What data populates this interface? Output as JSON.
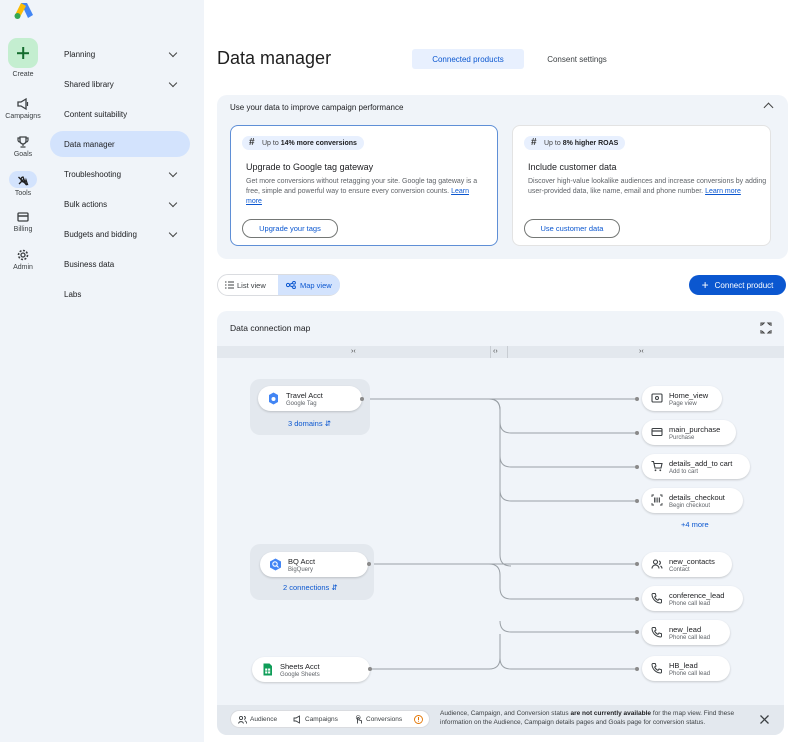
{
  "rail": {
    "items": [
      {
        "label": "Create",
        "icon": "plus-icon"
      },
      {
        "label": "Campaigns",
        "icon": "megaphone-icon"
      },
      {
        "label": "Goals",
        "icon": "trophy-icon"
      },
      {
        "label": "Tools",
        "icon": "tools-icon"
      },
      {
        "label": "Billing",
        "icon": "card-icon"
      },
      {
        "label": "Admin",
        "icon": "gear-icon"
      }
    ]
  },
  "subnav": {
    "items": [
      {
        "label": "Planning",
        "expandable": true
      },
      {
        "label": "Shared library",
        "expandable": true
      },
      {
        "label": "Content suitability",
        "expandable": false
      },
      {
        "label": "Data manager",
        "expandable": false,
        "active": true
      },
      {
        "label": "Troubleshooting",
        "expandable": true
      },
      {
        "label": "Bulk actions",
        "expandable": true
      },
      {
        "label": "Budgets and bidding",
        "expandable": true
      },
      {
        "label": "Business data",
        "expandable": false
      },
      {
        "label": "Labs",
        "expandable": false
      }
    ]
  },
  "header": {
    "title": "Data manager",
    "tabs": [
      "Connected products",
      "Consent settings"
    ]
  },
  "promo": {
    "heading": "Use your data to improve campaign performance",
    "cards": [
      {
        "chip_prefix": "Up to ",
        "chip_bold": "14% more conversions",
        "title": "Upgrade to Google tag gateway",
        "desc": "Get more conversions without retagging your site. Google tag gateway is a free, simple and powerful way to ensure every conversion counts.",
        "link": "Learn more",
        "button": "Upgrade your tags"
      },
      {
        "chip_prefix": "Up to ",
        "chip_bold": "8% higher ROAS",
        "title": "Include customer data",
        "desc": "Discover high-value lookalike audiences and increase conversions by adding user-provided data, like name, email and phone number.",
        "link": "Learn more",
        "button": "Use customer data"
      }
    ]
  },
  "view_toggle": {
    "list": "List view",
    "map": "Map view"
  },
  "connect_button": "Connect product",
  "map": {
    "title": "Data connection map",
    "sources": [
      {
        "name": "Travel Acct",
        "type": "Google Tag",
        "link": "3 domains"
      },
      {
        "name": "BQ Acct",
        "type": "BigQuery",
        "link": "2 connections"
      },
      {
        "name": "Sheets Acct",
        "type": "Google Sheets"
      }
    ],
    "destinations": [
      {
        "name": "Home_view",
        "type": "Page view"
      },
      {
        "name": "main_purchase",
        "type": "Purchase"
      },
      {
        "name": "details_add_to cart",
        "type": "Add to cart"
      },
      {
        "name": "details_checkout",
        "type": "Begin checkout"
      },
      {
        "name": "new_contacts",
        "type": "Contact"
      },
      {
        "name": "conference_lead",
        "type": "Phone call lead"
      },
      {
        "name": "new_lead",
        "type": "Phone call lead"
      },
      {
        "name": "HB_lead",
        "type": "Phone call lead"
      }
    ],
    "more_link": "+4 more"
  },
  "footer": {
    "legend": [
      "Audience",
      "Campaigns",
      "Conversions"
    ],
    "text_a": "Audience, Campaign, and Conversion status ",
    "text_bold": "are not currently available",
    "text_b": " for the map view. Find these information on the Audience, Campaign details pages and Goals page for conversion status."
  },
  "colors": {
    "accent": "#0b57d0",
    "accent_light": "#d3e3fd",
    "create_green": "#c4eed0"
  }
}
